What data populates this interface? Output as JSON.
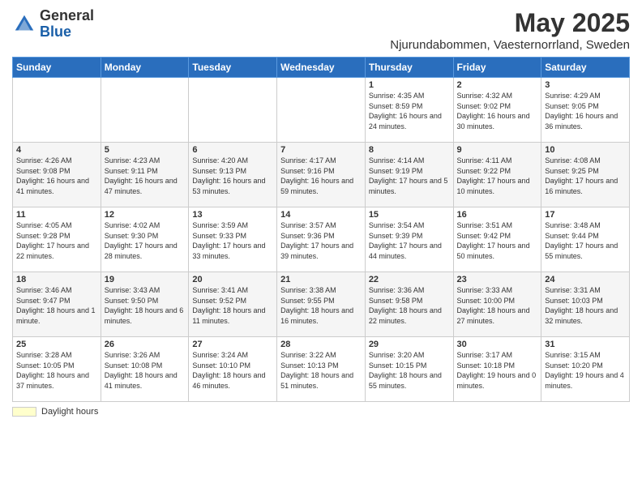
{
  "header": {
    "logo_general": "General",
    "logo_blue": "Blue",
    "title": "May 2025",
    "subtitle": "Njurundabommen, Vaesternorrland, Sweden"
  },
  "weekdays": [
    "Sunday",
    "Monday",
    "Tuesday",
    "Wednesday",
    "Thursday",
    "Friday",
    "Saturday"
  ],
  "weeks": [
    [
      {
        "day": "",
        "info": ""
      },
      {
        "day": "",
        "info": ""
      },
      {
        "day": "",
        "info": ""
      },
      {
        "day": "",
        "info": ""
      },
      {
        "day": "1",
        "info": "Sunrise: 4:35 AM\nSunset: 8:59 PM\nDaylight: 16 hours\nand 24 minutes."
      },
      {
        "day": "2",
        "info": "Sunrise: 4:32 AM\nSunset: 9:02 PM\nDaylight: 16 hours\nand 30 minutes."
      },
      {
        "day": "3",
        "info": "Sunrise: 4:29 AM\nSunset: 9:05 PM\nDaylight: 16 hours\nand 36 minutes."
      }
    ],
    [
      {
        "day": "4",
        "info": "Sunrise: 4:26 AM\nSunset: 9:08 PM\nDaylight: 16 hours\nand 41 minutes."
      },
      {
        "day": "5",
        "info": "Sunrise: 4:23 AM\nSunset: 9:11 PM\nDaylight: 16 hours\nand 47 minutes."
      },
      {
        "day": "6",
        "info": "Sunrise: 4:20 AM\nSunset: 9:13 PM\nDaylight: 16 hours\nand 53 minutes."
      },
      {
        "day": "7",
        "info": "Sunrise: 4:17 AM\nSunset: 9:16 PM\nDaylight: 16 hours\nand 59 minutes."
      },
      {
        "day": "8",
        "info": "Sunrise: 4:14 AM\nSunset: 9:19 PM\nDaylight: 17 hours\nand 5 minutes."
      },
      {
        "day": "9",
        "info": "Sunrise: 4:11 AM\nSunset: 9:22 PM\nDaylight: 17 hours\nand 10 minutes."
      },
      {
        "day": "10",
        "info": "Sunrise: 4:08 AM\nSunset: 9:25 PM\nDaylight: 17 hours\nand 16 minutes."
      }
    ],
    [
      {
        "day": "11",
        "info": "Sunrise: 4:05 AM\nSunset: 9:28 PM\nDaylight: 17 hours\nand 22 minutes."
      },
      {
        "day": "12",
        "info": "Sunrise: 4:02 AM\nSunset: 9:30 PM\nDaylight: 17 hours\nand 28 minutes."
      },
      {
        "day": "13",
        "info": "Sunrise: 3:59 AM\nSunset: 9:33 PM\nDaylight: 17 hours\nand 33 minutes."
      },
      {
        "day": "14",
        "info": "Sunrise: 3:57 AM\nSunset: 9:36 PM\nDaylight: 17 hours\nand 39 minutes."
      },
      {
        "day": "15",
        "info": "Sunrise: 3:54 AM\nSunset: 9:39 PM\nDaylight: 17 hours\nand 44 minutes."
      },
      {
        "day": "16",
        "info": "Sunrise: 3:51 AM\nSunset: 9:42 PM\nDaylight: 17 hours\nand 50 minutes."
      },
      {
        "day": "17",
        "info": "Sunrise: 3:48 AM\nSunset: 9:44 PM\nDaylight: 17 hours\nand 55 minutes."
      }
    ],
    [
      {
        "day": "18",
        "info": "Sunrise: 3:46 AM\nSunset: 9:47 PM\nDaylight: 18 hours\nand 1 minute."
      },
      {
        "day": "19",
        "info": "Sunrise: 3:43 AM\nSunset: 9:50 PM\nDaylight: 18 hours\nand 6 minutes."
      },
      {
        "day": "20",
        "info": "Sunrise: 3:41 AM\nSunset: 9:52 PM\nDaylight: 18 hours\nand 11 minutes."
      },
      {
        "day": "21",
        "info": "Sunrise: 3:38 AM\nSunset: 9:55 PM\nDaylight: 18 hours\nand 16 minutes."
      },
      {
        "day": "22",
        "info": "Sunrise: 3:36 AM\nSunset: 9:58 PM\nDaylight: 18 hours\nand 22 minutes."
      },
      {
        "day": "23",
        "info": "Sunrise: 3:33 AM\nSunset: 10:00 PM\nDaylight: 18 hours\nand 27 minutes."
      },
      {
        "day": "24",
        "info": "Sunrise: 3:31 AM\nSunset: 10:03 PM\nDaylight: 18 hours\nand 32 minutes."
      }
    ],
    [
      {
        "day": "25",
        "info": "Sunrise: 3:28 AM\nSunset: 10:05 PM\nDaylight: 18 hours\nand 37 minutes."
      },
      {
        "day": "26",
        "info": "Sunrise: 3:26 AM\nSunset: 10:08 PM\nDaylight: 18 hours\nand 41 minutes."
      },
      {
        "day": "27",
        "info": "Sunrise: 3:24 AM\nSunset: 10:10 PM\nDaylight: 18 hours\nand 46 minutes."
      },
      {
        "day": "28",
        "info": "Sunrise: 3:22 AM\nSunset: 10:13 PM\nDaylight: 18 hours\nand 51 minutes."
      },
      {
        "day": "29",
        "info": "Sunrise: 3:20 AM\nSunset: 10:15 PM\nDaylight: 18 hours\nand 55 minutes."
      },
      {
        "day": "30",
        "info": "Sunrise: 3:17 AM\nSunset: 10:18 PM\nDaylight: 19 hours\nand 0 minutes."
      },
      {
        "day": "31",
        "info": "Sunrise: 3:15 AM\nSunset: 10:20 PM\nDaylight: 19 hours\nand 4 minutes."
      }
    ]
  ],
  "legend": {
    "box_color": "#ffffcc",
    "label": "Daylight hours"
  }
}
